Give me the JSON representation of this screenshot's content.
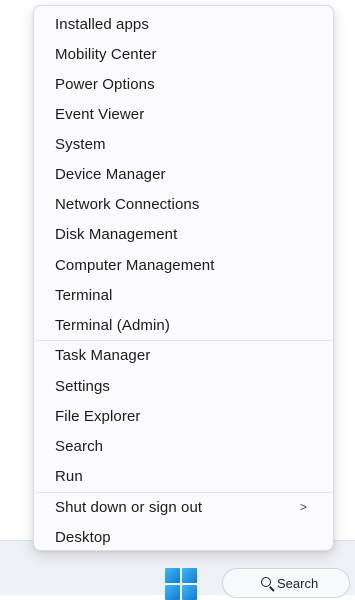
{
  "menu": {
    "items": [
      {
        "label": "Installed apps"
      },
      {
        "label": "Mobility Center"
      },
      {
        "label": "Power Options"
      },
      {
        "label": "Event Viewer"
      },
      {
        "label": "System"
      },
      {
        "label": "Device Manager"
      },
      {
        "label": "Network Connections"
      },
      {
        "label": "Disk Management"
      },
      {
        "label": "Computer Management"
      },
      {
        "label": "Terminal"
      },
      {
        "label": "Terminal (Admin)"
      },
      {
        "label": "Task Manager"
      },
      {
        "label": "Settings"
      },
      {
        "label": "File Explorer"
      },
      {
        "label": "Search"
      },
      {
        "label": "Run"
      },
      {
        "label": "Shut down or sign out",
        "submenu_indicator": ">"
      },
      {
        "label": "Desktop"
      }
    ]
  },
  "taskbar": {
    "start_icon": "windows-logo-icon",
    "search": {
      "icon": "search-icon",
      "label": "Search"
    }
  }
}
